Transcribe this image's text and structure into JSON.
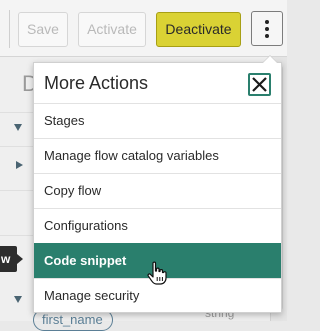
{
  "toolbar": {
    "save_label": "Save",
    "activate_label": "Activate",
    "deactivate_label": "Deactivate",
    "more_icon": "kebab-vertical-icon"
  },
  "background": {
    "heading_fragment": "D",
    "tooltip_fragment": "w",
    "field_pill": "first_name",
    "field_type": "string"
  },
  "menu": {
    "title": "More Actions",
    "close_icon": "close-icon",
    "items": [
      {
        "label": "Stages"
      },
      {
        "label": "Manage flow catalog variables"
      },
      {
        "label": "Copy flow"
      },
      {
        "label": "Configurations"
      },
      {
        "label": "Code snippet",
        "active": true
      },
      {
        "label": "Manage security"
      }
    ]
  },
  "colors": {
    "accent": "#2a7f6d",
    "deactivate": "#dad234"
  }
}
